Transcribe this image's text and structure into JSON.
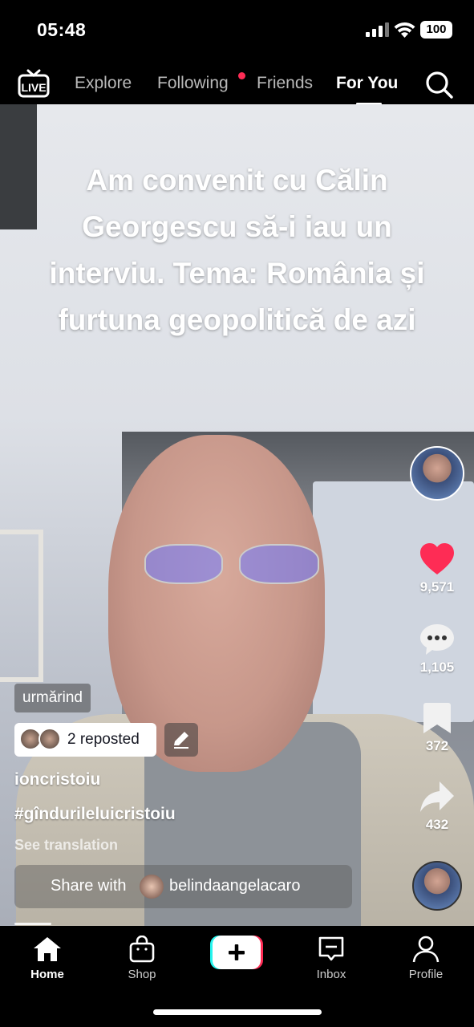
{
  "status_bar": {
    "time": "05:48",
    "battery": "100"
  },
  "top_nav": {
    "tabs": [
      {
        "label": "Explore"
      },
      {
        "label": "Following"
      },
      {
        "label": "Friends"
      },
      {
        "label": "For You"
      }
    ],
    "active_tab": "For You"
  },
  "video": {
    "caption": "Am convenit cu Călin Georgescu să-i iau un interviu. Tema: România și furtuna geopolitică de azi"
  },
  "right_rail": {
    "likes": "9,571",
    "comments": "1,105",
    "saves": "372",
    "shares": "432"
  },
  "meta": {
    "following_chip": "urmărind",
    "reposted_label": "2 reposted",
    "username": "ioncristoiu",
    "hashtag": "#gîndurileluicristoiu",
    "see_translation": "See translation",
    "share_with_label": "Share with",
    "share_with_user": "belindaangelacaro"
  },
  "tab_bar": {
    "home": "Home",
    "shop": "Shop",
    "inbox": "Inbox",
    "profile": "Profile"
  },
  "colors": {
    "accent": "#fe2c55",
    "like": "#fe2c55",
    "create_cyan": "#25f4ee"
  }
}
